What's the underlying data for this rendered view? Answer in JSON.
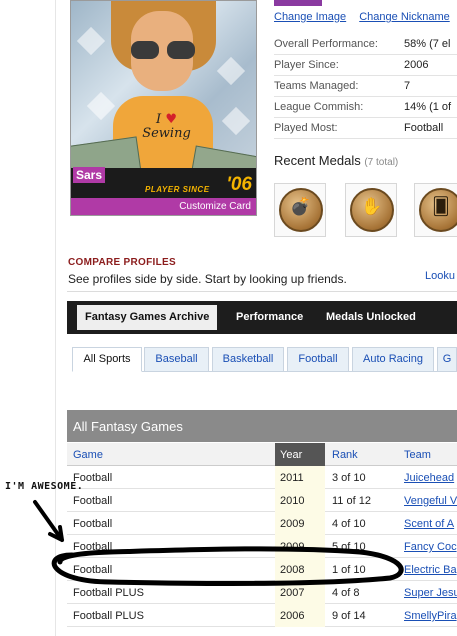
{
  "card": {
    "name": "Sars",
    "player_since_label": "PLAYER SINCE",
    "player_since_year": "'06",
    "customize_label": "Customize Card",
    "shirt_line1": "I",
    "shirt_line2": "Sewing"
  },
  "profile_links": {
    "change_image": "Change Image",
    "change_nickname": "Change Nickname"
  },
  "stats": [
    {
      "label": "Overall Performance:",
      "value": "58% (7 el"
    },
    {
      "label": "Player Since:",
      "value": "2006"
    },
    {
      "label": "Teams Managed:",
      "value": "7"
    },
    {
      "label": "League Commish:",
      "value": "14% (1 of"
    },
    {
      "label": "Played Most:",
      "value": "Football"
    }
  ],
  "medals": {
    "title": "Recent Medals",
    "count": "(7 total)",
    "items": [
      {
        "icon": "bomb-icon",
        "glyph": "💣"
      },
      {
        "icon": "grip-icon",
        "glyph": "✋"
      },
      {
        "icon": "card-icon",
        "glyph": "🂠"
      }
    ]
  },
  "compare": {
    "title": "COMPARE PROFILES",
    "text": "See profiles side by side. Start by looking up friends.",
    "lookup": "Looku"
  },
  "main_tabs": [
    "Fantasy Games Archive",
    "Performance",
    "Medals Unlocked"
  ],
  "sport_tabs": [
    "All Sports",
    "Baseball",
    "Basketball",
    "Football",
    "Auto Racing",
    "G"
  ],
  "table": {
    "title": "All Fantasy Games",
    "columns": {
      "game": "Game",
      "year": "Year",
      "rank": "Rank",
      "team": "Team"
    },
    "rows": [
      {
        "game": "Football",
        "year": "2011",
        "rank": "3 of 10",
        "team": "Juicehead"
      },
      {
        "game": "Football",
        "year": "2010",
        "rank": "11 of 12",
        "team": "Vengeful V"
      },
      {
        "game": "Football",
        "year": "2009",
        "rank": "4 of 10",
        "team": "Scent of A"
      },
      {
        "game": "Football",
        "year": "2009",
        "rank": "5 of 10",
        "team": "Fancy Coc"
      },
      {
        "game": "Football",
        "year": "2008",
        "rank": "1 of 10",
        "team": "Electric Ba"
      },
      {
        "game": "Football PLUS",
        "year": "2007",
        "rank": "4 of 8",
        "team": "Super Jesu"
      },
      {
        "game": "Football PLUS",
        "year": "2006",
        "rank": "9 of 14",
        "team": "SmellyPira"
      }
    ]
  },
  "annotation": {
    "text": "I'M AWESOME."
  },
  "colors": {
    "accent_purple": "#b03aa6",
    "link_blue": "#1a4fb5",
    "gold": "#f4b400",
    "header_red": "#8b1c1c"
  }
}
